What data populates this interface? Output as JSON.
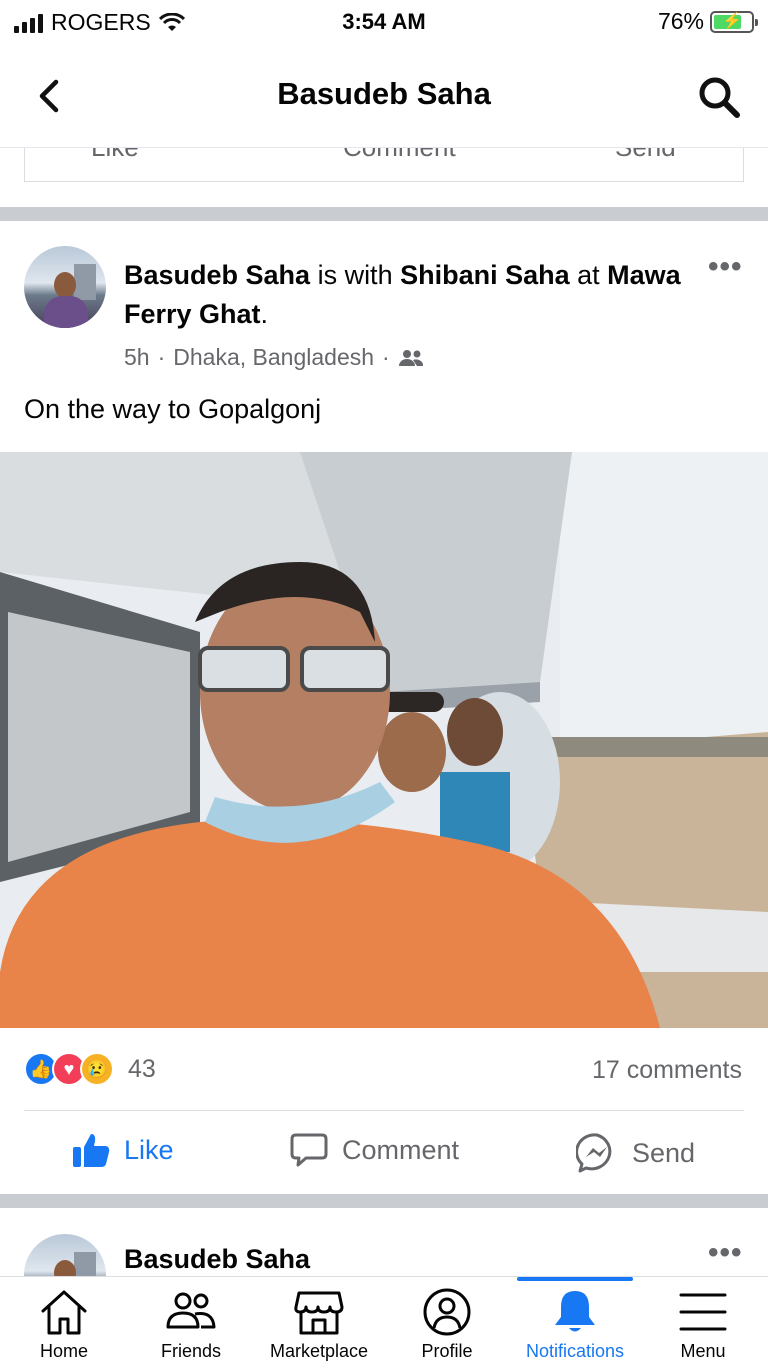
{
  "status_bar": {
    "carrier": "ROGERS",
    "time": "3:54 AM",
    "battery": "76%",
    "battery_level": 0.76
  },
  "header": {
    "title": "Basudeb Saha",
    "back_icon": "chevron-left-icon",
    "search_icon": "search-icon"
  },
  "prev_post_actions": [
    "Like",
    "Comment",
    "Send"
  ],
  "post": {
    "author": "Basudeb Saha",
    "with_word": " is with ",
    "tagged": "Shibani Saha",
    "at_word": " at ",
    "place": "Mawa Ferry Ghat",
    "period": ".",
    "time": "5h",
    "location": "Dhaka, Bangladesh",
    "dot": "·",
    "audience_icon": "friends-icon",
    "text": "On the way to Gopalgonj",
    "reaction_count": "43",
    "comments": "17 comments",
    "reactions": [
      "like",
      "love",
      "sad"
    ],
    "actions": {
      "like": "Like",
      "comment": "Comment",
      "send": "Send"
    }
  },
  "next_post": {
    "author": "Basudeb Saha"
  },
  "tabs": [
    {
      "label": "Home",
      "icon": "home-icon"
    },
    {
      "label": "Friends",
      "icon": "friends-icon"
    },
    {
      "label": "Marketplace",
      "icon": "marketplace-icon"
    },
    {
      "label": "Profile",
      "icon": "profile-icon"
    },
    {
      "label": "Notifications",
      "icon": "bell-icon",
      "active": true
    },
    {
      "label": "Menu",
      "icon": "menu-icon"
    }
  ],
  "colors": {
    "accent": "#1877f2",
    "secondary_text": "#65676b",
    "divider": "#c9ccd1"
  }
}
